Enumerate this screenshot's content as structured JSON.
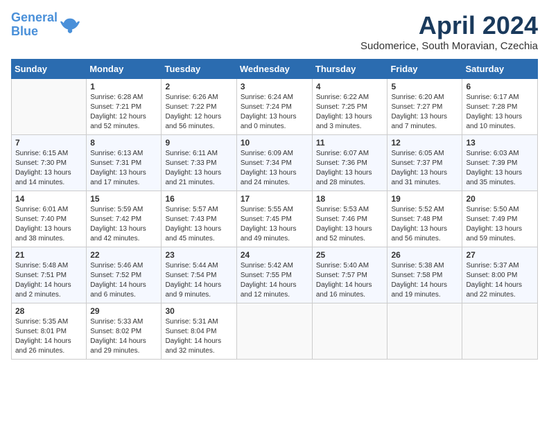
{
  "header": {
    "logo_line1": "General",
    "logo_line2": "Blue",
    "month": "April 2024",
    "location": "Sudomerice, South Moravian, Czechia"
  },
  "weekdays": [
    "Sunday",
    "Monday",
    "Tuesday",
    "Wednesday",
    "Thursday",
    "Friday",
    "Saturday"
  ],
  "weeks": [
    [
      {
        "day": "",
        "content": ""
      },
      {
        "day": "1",
        "content": "Sunrise: 6:28 AM\nSunset: 7:21 PM\nDaylight: 12 hours\nand 52 minutes."
      },
      {
        "day": "2",
        "content": "Sunrise: 6:26 AM\nSunset: 7:22 PM\nDaylight: 12 hours\nand 56 minutes."
      },
      {
        "day": "3",
        "content": "Sunrise: 6:24 AM\nSunset: 7:24 PM\nDaylight: 13 hours\nand 0 minutes."
      },
      {
        "day": "4",
        "content": "Sunrise: 6:22 AM\nSunset: 7:25 PM\nDaylight: 13 hours\nand 3 minutes."
      },
      {
        "day": "5",
        "content": "Sunrise: 6:20 AM\nSunset: 7:27 PM\nDaylight: 13 hours\nand 7 minutes."
      },
      {
        "day": "6",
        "content": "Sunrise: 6:17 AM\nSunset: 7:28 PM\nDaylight: 13 hours\nand 10 minutes."
      }
    ],
    [
      {
        "day": "7",
        "content": "Sunrise: 6:15 AM\nSunset: 7:30 PM\nDaylight: 13 hours\nand 14 minutes."
      },
      {
        "day": "8",
        "content": "Sunrise: 6:13 AM\nSunset: 7:31 PM\nDaylight: 13 hours\nand 17 minutes."
      },
      {
        "day": "9",
        "content": "Sunrise: 6:11 AM\nSunset: 7:33 PM\nDaylight: 13 hours\nand 21 minutes."
      },
      {
        "day": "10",
        "content": "Sunrise: 6:09 AM\nSunset: 7:34 PM\nDaylight: 13 hours\nand 24 minutes."
      },
      {
        "day": "11",
        "content": "Sunrise: 6:07 AM\nSunset: 7:36 PM\nDaylight: 13 hours\nand 28 minutes."
      },
      {
        "day": "12",
        "content": "Sunrise: 6:05 AM\nSunset: 7:37 PM\nDaylight: 13 hours\nand 31 minutes."
      },
      {
        "day": "13",
        "content": "Sunrise: 6:03 AM\nSunset: 7:39 PM\nDaylight: 13 hours\nand 35 minutes."
      }
    ],
    [
      {
        "day": "14",
        "content": "Sunrise: 6:01 AM\nSunset: 7:40 PM\nDaylight: 13 hours\nand 38 minutes."
      },
      {
        "day": "15",
        "content": "Sunrise: 5:59 AM\nSunset: 7:42 PM\nDaylight: 13 hours\nand 42 minutes."
      },
      {
        "day": "16",
        "content": "Sunrise: 5:57 AM\nSunset: 7:43 PM\nDaylight: 13 hours\nand 45 minutes."
      },
      {
        "day": "17",
        "content": "Sunrise: 5:55 AM\nSunset: 7:45 PM\nDaylight: 13 hours\nand 49 minutes."
      },
      {
        "day": "18",
        "content": "Sunrise: 5:53 AM\nSunset: 7:46 PM\nDaylight: 13 hours\nand 52 minutes."
      },
      {
        "day": "19",
        "content": "Sunrise: 5:52 AM\nSunset: 7:48 PM\nDaylight: 13 hours\nand 56 minutes."
      },
      {
        "day": "20",
        "content": "Sunrise: 5:50 AM\nSunset: 7:49 PM\nDaylight: 13 hours\nand 59 minutes."
      }
    ],
    [
      {
        "day": "21",
        "content": "Sunrise: 5:48 AM\nSunset: 7:51 PM\nDaylight: 14 hours\nand 2 minutes."
      },
      {
        "day": "22",
        "content": "Sunrise: 5:46 AM\nSunset: 7:52 PM\nDaylight: 14 hours\nand 6 minutes."
      },
      {
        "day": "23",
        "content": "Sunrise: 5:44 AM\nSunset: 7:54 PM\nDaylight: 14 hours\nand 9 minutes."
      },
      {
        "day": "24",
        "content": "Sunrise: 5:42 AM\nSunset: 7:55 PM\nDaylight: 14 hours\nand 12 minutes."
      },
      {
        "day": "25",
        "content": "Sunrise: 5:40 AM\nSunset: 7:57 PM\nDaylight: 14 hours\nand 16 minutes."
      },
      {
        "day": "26",
        "content": "Sunrise: 5:38 AM\nSunset: 7:58 PM\nDaylight: 14 hours\nand 19 minutes."
      },
      {
        "day": "27",
        "content": "Sunrise: 5:37 AM\nSunset: 8:00 PM\nDaylight: 14 hours\nand 22 minutes."
      }
    ],
    [
      {
        "day": "28",
        "content": "Sunrise: 5:35 AM\nSunset: 8:01 PM\nDaylight: 14 hours\nand 26 minutes."
      },
      {
        "day": "29",
        "content": "Sunrise: 5:33 AM\nSunset: 8:02 PM\nDaylight: 14 hours\nand 29 minutes."
      },
      {
        "day": "30",
        "content": "Sunrise: 5:31 AM\nSunset: 8:04 PM\nDaylight: 14 hours\nand 32 minutes."
      },
      {
        "day": "",
        "content": ""
      },
      {
        "day": "",
        "content": ""
      },
      {
        "day": "",
        "content": ""
      },
      {
        "day": "",
        "content": ""
      }
    ]
  ]
}
